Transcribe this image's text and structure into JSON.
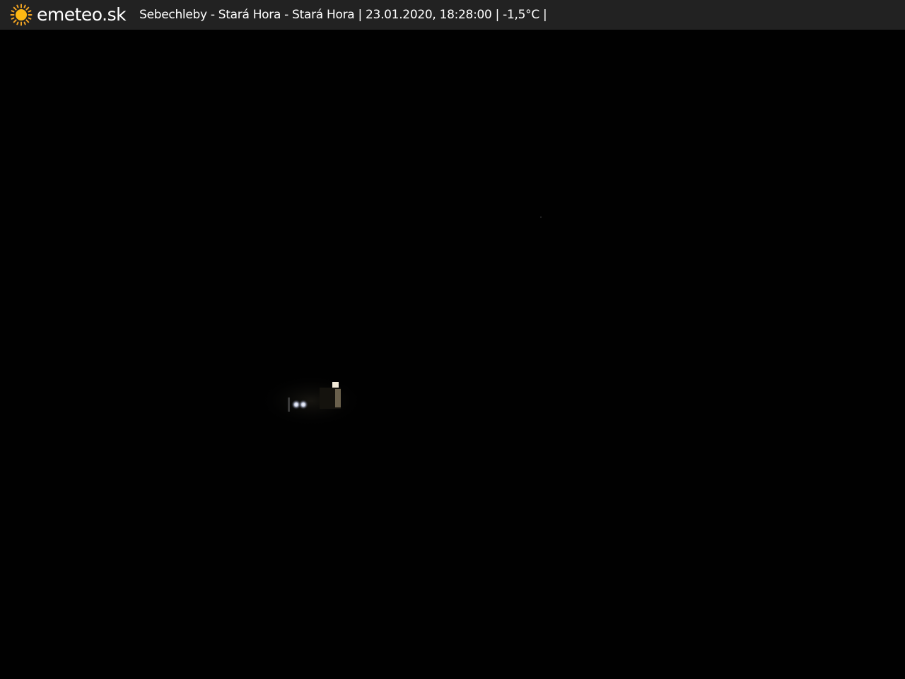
{
  "header": {
    "brand": "emeteo.sk",
    "logo_icon": "sun-icon",
    "caption": "Sebechleby - Stará Hora - Stará Hora | 23.01.2020, 18:28:00 | -1,5°C |"
  },
  "colors": {
    "bar_background": "#222222",
    "sun_color": "#f5a623",
    "text": "#ffffff",
    "image_background": "#010101"
  }
}
